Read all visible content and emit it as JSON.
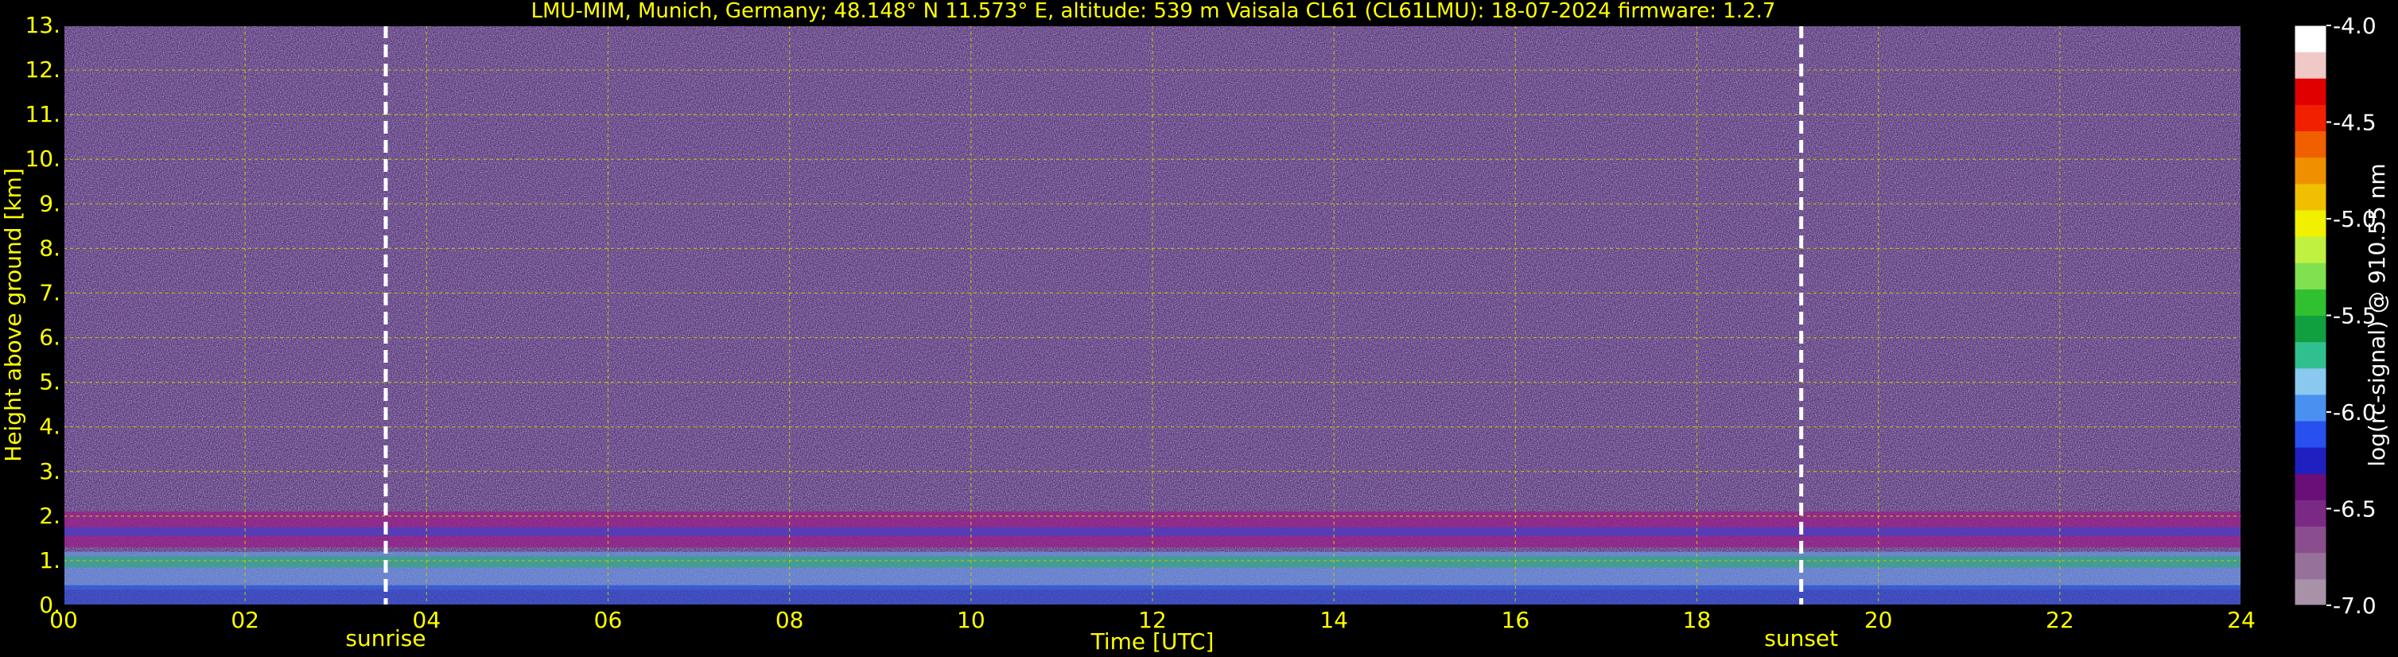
{
  "title": "LMU-MIM, Munich, Germany; 48.148° N 11.573° E, altitude: 539 m    Vaisala CL61 (CL61LMU): 18-07-2024    firmware: 1.2.7",
  "chart_data": {
    "type": "heatmap",
    "title": "LMU-MIM, Munich, Germany; 48.148° N 11.573° E, altitude: 539 m    Vaisala CL61 (CL61LMU): 18-07-2024    firmware: 1.2.7",
    "xlabel": "Time [UTC]",
    "ylabel": "Height above ground [km]",
    "xlim": [
      0,
      24
    ],
    "ylim": [
      0,
      13
    ],
    "x_ticks": [
      "00",
      "02",
      "04",
      "06",
      "08",
      "10",
      "12",
      "14",
      "16",
      "18",
      "20",
      "22",
      "24"
    ],
    "y_ticks": [
      "0.",
      "1.",
      "2.",
      "3.",
      "4.",
      "5.",
      "6.",
      "7.",
      "8.",
      "9.",
      "10.",
      "11.",
      "12.",
      "13."
    ],
    "grid": true,
    "events": [
      {
        "label": "sunrise",
        "time": 3.55
      },
      {
        "label": "sunset",
        "time": 19.15
      }
    ],
    "colorbar": {
      "label": "log(rc-signal) @ 910.55 nm",
      "range": [
        -7.0,
        -4.0
      ],
      "ticks": [
        "-4.0",
        "-4.5",
        "-5.0",
        "-5.5",
        "-6.0",
        "-6.5",
        "-7.0"
      ],
      "colors": [
        "#a892a8",
        "#96729a",
        "#8a4e8e",
        "#7a2a84",
        "#6a0e78",
        "#2020c0",
        "#2850f0",
        "#4a90f0",
        "#8ac8f0",
        "#30c090",
        "#10a040",
        "#30c030",
        "#80e050",
        "#c0f040",
        "#f0f000",
        "#f0c000",
        "#f09000",
        "#f06000",
        "#f02000",
        "#e00000",
        "#f0c8c8",
        "#ffffff"
      ]
    },
    "layers_note_free": false
  },
  "colors": {
    "background": "#000000",
    "text": "#ffff00",
    "grid": "#c8c800",
    "event_line": "#ffffff"
  }
}
